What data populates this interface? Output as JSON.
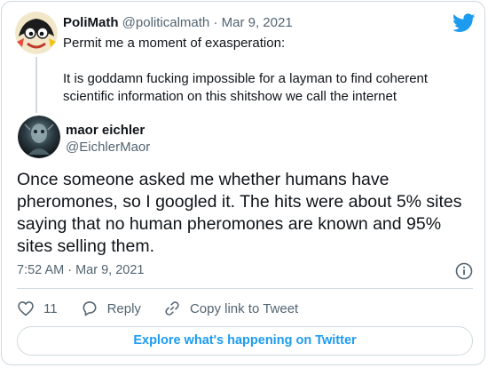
{
  "quoted_tweet": {
    "name": "PoliMath",
    "handle": "@politicalmath",
    "separator": "·",
    "date": "Mar 9, 2021",
    "lines": [
      "Permit me a moment of exasperation:",
      "It is goddamn fucking impossible for a layman to find coherent scientific information on this shitshow we call the internet"
    ],
    "avatar_icon": "cartoon-avatar"
  },
  "tweet": {
    "name": "maor eichler",
    "handle": "@EichlerMaor",
    "text": "Once someone asked me whether humans have pheromones, so I googled it. The hits were about 5% sites saying that no human pheromones are known and 95% sites selling them.",
    "timestamp": "7:52 AM · Mar 9, 2021",
    "avatar_icon": "dark-photo-avatar"
  },
  "actions": {
    "like_count": "11",
    "reply_label": "Reply",
    "copy_label": "Copy link to Tweet"
  },
  "explore_label": "Explore what's happening on Twitter",
  "icons": {
    "brand": "twitter-bird-icon",
    "info": "info-icon",
    "like": "heart-icon",
    "reply": "reply-bubble-icon",
    "copy": "link-icon"
  },
  "colors": {
    "brand_blue": "#1d9bf0",
    "secondary_text": "#536471",
    "border": "#cfd9de"
  }
}
